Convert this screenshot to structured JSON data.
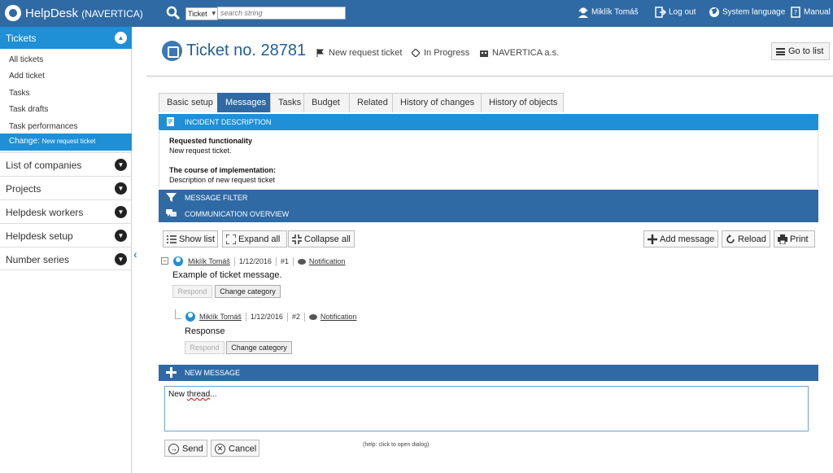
{
  "topbar": {
    "app_name": "HelpDesk",
    "app_org": "(NAVERTICA)",
    "search": {
      "type_selected": "Ticket",
      "placeholder": "search string"
    },
    "user_name": "Miklík Tomáš",
    "logout_label": "Log out",
    "system_language_label": "System language",
    "manual_label": "Manual"
  },
  "sidebar": {
    "tickets_label": "Tickets",
    "ticket_items": [
      "All tickets",
      "Add ticket",
      "Tasks",
      "Task drafts",
      "Task performances"
    ],
    "active_item_prefix": "Change:",
    "active_item_detail": "New request ticket",
    "sections": [
      "List of companies",
      "Projects",
      "Helpdesk workers",
      "Helpdesk setup",
      "Number series"
    ]
  },
  "header": {
    "title": "Ticket no. 28781",
    "type": "New request ticket",
    "status": "In Progress",
    "company": "NAVERTICA a.s.",
    "go_to_list": "Go to list"
  },
  "tabs": [
    "Basic setup",
    "Messages",
    "Tasks",
    "Budget",
    "Related",
    "History of changes",
    "History of objects"
  ],
  "active_tab": "Messages",
  "incident": {
    "bar_label": "INCIDENT DESCRIPTION",
    "req_heading": "Requested functionality",
    "req_text": "New request ticket.",
    "course_heading": "The course of implementation:",
    "course_text": "Description of new request ticket"
  },
  "message_filter_label": "MESSAGE FILTER",
  "communication_label": "COMMUNICATION OVERVIEW",
  "toolbar": {
    "show_list": "Show list",
    "expand_all": "Expand all",
    "collapse_all": "Collapse all",
    "add_message": "Add message",
    "reload": "Reload",
    "print": "Print"
  },
  "messages": [
    {
      "author": "Miklík Tomáš",
      "date": "1/12/2016",
      "number": "#1",
      "kind": "Notification",
      "text": "Example of ticket message.",
      "respond": "Respond",
      "change_category": "Change category"
    },
    {
      "author": "Miklík Tomáš",
      "date": "1/12/2016",
      "number": "#2",
      "kind": "Notification",
      "text": "Response",
      "respond": "Respond",
      "change_category": "Change category"
    }
  ],
  "new_message": {
    "bar_label": "NEW MESSAGE",
    "text_prefix": "New ",
    "text_word": "thread",
    "text_suffix": "...",
    "send": "Send",
    "cancel": "Cancel",
    "help": "(help: click to open dialog)"
  },
  "colors": {
    "topbar": "#2f6aa4",
    "accent": "#1f8fd6",
    "dark_bar": "#2f6aa4"
  }
}
